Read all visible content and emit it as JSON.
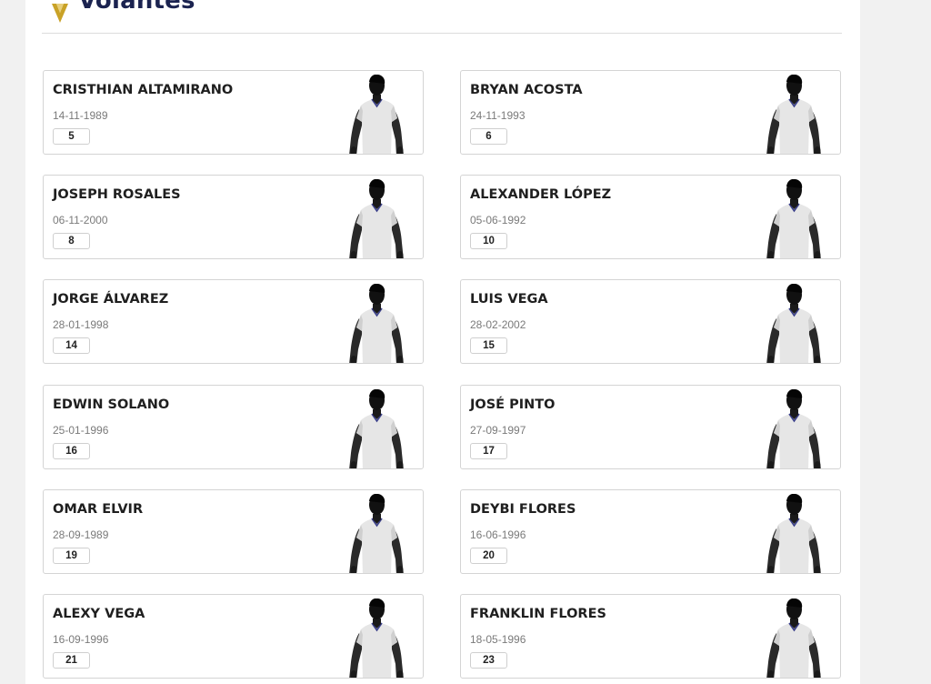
{
  "section": {
    "title": "Volantes"
  },
  "colors": {
    "title": "#1b2350",
    "logo_gold": "#c9a227"
  },
  "players": [
    {
      "name": "CRISTHIAN ALTAMIRANO",
      "dob": "14-11-1989",
      "number": "5"
    },
    {
      "name": "BRYAN ACOSTA",
      "dob": "24-11-1993",
      "number": "6"
    },
    {
      "name": "JOSEPH ROSALES",
      "dob": "06-11-2000",
      "number": "8"
    },
    {
      "name": "ALEXANDER LÓPEZ",
      "dob": "05-06-1992",
      "number": "10"
    },
    {
      "name": "JORGE ÁLVAREZ",
      "dob": "28-01-1998",
      "number": "14"
    },
    {
      "name": "LUIS VEGA",
      "dob": "28-02-2002",
      "number": "15"
    },
    {
      "name": "EDWIN SOLANO",
      "dob": "25-01-1996",
      "number": "16"
    },
    {
      "name": "JOSÉ PINTO",
      "dob": "27-09-1997",
      "number": "17"
    },
    {
      "name": "OMAR ELVIR",
      "dob": "28-09-1989",
      "number": "19"
    },
    {
      "name": "DEYBI FLORES",
      "dob": "16-06-1996",
      "number": "20"
    },
    {
      "name": "ALEXY VEGA",
      "dob": "16-09-1996",
      "number": "21"
    },
    {
      "name": "FRANKLIN FLORES",
      "dob": "18-05-1996",
      "number": "23"
    }
  ]
}
